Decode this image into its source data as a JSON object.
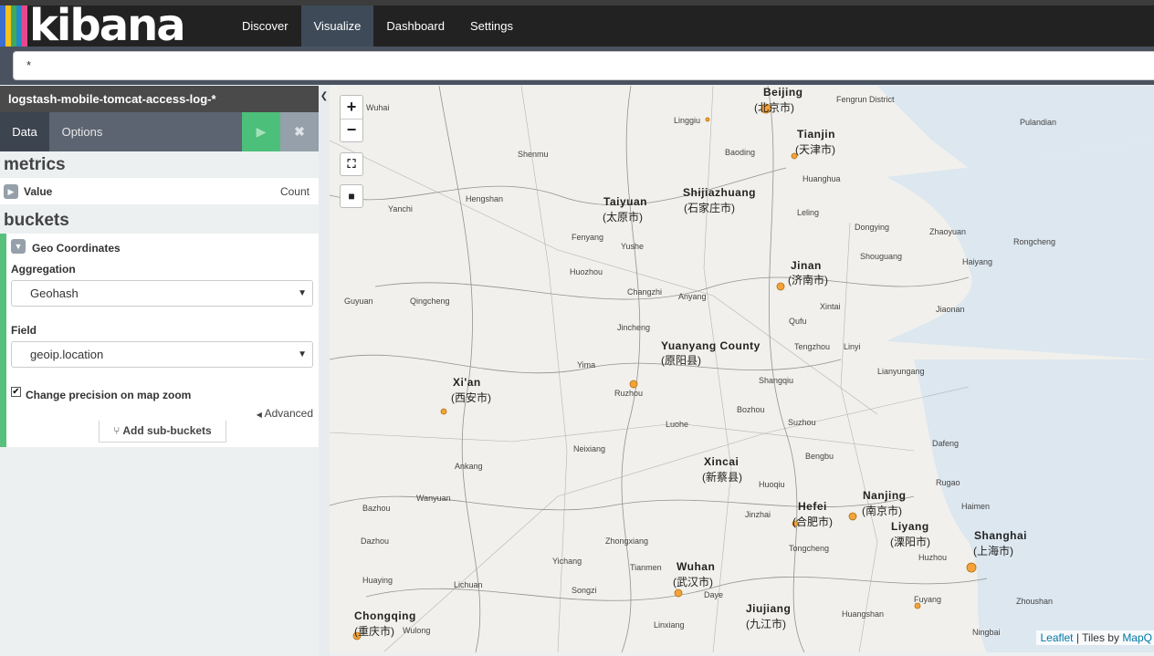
{
  "app": {
    "logo": "kibana",
    "stripe_colors": [
      "#3b6fd1",
      "#f6c21c",
      "#3da95c",
      "#1f8bca",
      "#e8488b"
    ],
    "nav": [
      "Discover",
      "Visualize",
      "Dashboard",
      "Settings"
    ],
    "active_nav": "Visualize"
  },
  "query": {
    "value": "*"
  },
  "sidebar": {
    "index_pattern": "logstash-mobile-tomcat-access-log-*",
    "tabs": [
      "Data",
      "Options"
    ],
    "apply_icon": "▶",
    "discard_icon": "✖",
    "metrics_header": "metrics",
    "metric": {
      "label": "Value",
      "value": "Count"
    },
    "buckets_header": "buckets",
    "bucket": {
      "type": "Geo Coordinates",
      "aggregation_label": "Aggregation",
      "aggregation_value": "Geohash",
      "field_label": "Field",
      "field_value": "geoip.location",
      "checkbox_label": "Change precision on map zoom",
      "checkbox_checked": true,
      "advanced_label": "Advanced",
      "add_sub_label": "Add sub-buckets"
    }
  },
  "map": {
    "zoom_in": "+",
    "zoom_out": "−",
    "attribution_link": "Leaflet",
    "attribution_text": " | Tiles by ",
    "attribution_tiles": "MapQ",
    "cities": [
      {
        "en": "Beijing",
        "cn": "(北京市)"
      },
      {
        "en": "Tianjin",
        "cn": "(天津市)"
      },
      {
        "en": "Shijiazhuang",
        "cn": "(石家庄市)"
      },
      {
        "en": "Taiyuan",
        "cn": "(太原市)"
      },
      {
        "en": "Jinan",
        "cn": "(济南市)"
      },
      {
        "en": "Yuanyang County",
        "cn": "(原阳县)"
      },
      {
        "en": "Xi'an",
        "cn": "(西安市)"
      },
      {
        "en": "Xincai",
        "cn": "(新蔡县)"
      },
      {
        "en": "Nanjing",
        "cn": "(南京市)"
      },
      {
        "en": "Hefei",
        "cn": "(合肥市)"
      },
      {
        "en": "Liyang",
        "cn": "(溧阳市)"
      },
      {
        "en": "Shanghai",
        "cn": "(上海市)"
      },
      {
        "en": "Wuhan",
        "cn": "(武汉市)"
      },
      {
        "en": "Jiujiang",
        "cn": "(九江市)"
      },
      {
        "en": "Chongqing",
        "cn": "(重庆市)"
      }
    ],
    "towns": [
      "Wuhai",
      "Linggiu",
      "Fengrun District",
      "Pulandian",
      "Shenmu",
      "Baoding",
      "Huanghua",
      "Yanchi",
      "Hengshan",
      "Leling",
      "Dongying",
      "Zhaoyuan",
      "Rongcheng",
      "Fenyang",
      "Yushe",
      "Shouguang",
      "Haiyang",
      "Guyuan",
      "Qingcheng",
      "Huozhou",
      "Changzhi",
      "Anyang",
      "Xintai",
      "Jiaonan",
      "Jincheng",
      "Qufu",
      "Tengzhou",
      "Linyi",
      "Yima",
      "Ruzhou",
      "Shangqiu",
      "Lianyungang",
      "Luohe",
      "Bozhou",
      "Suzhou",
      "Neixiang",
      "Bengbu",
      "Dafeng",
      "Ankang",
      "Huoqiu",
      "Rugao",
      "Wanyuan",
      "Jinzhai",
      "Haimen",
      "Bazhou",
      "Zhongxiang",
      "Dazhou",
      "Yichang",
      "Tianmen",
      "Tongcheng",
      "Huzhou",
      "Huaying",
      "Lichuan",
      "Songzi",
      "Daye",
      "Zhoushan",
      "Huangshan",
      "Fuyang",
      "Linxiang",
      "Wulong",
      "Ningbai"
    ]
  }
}
